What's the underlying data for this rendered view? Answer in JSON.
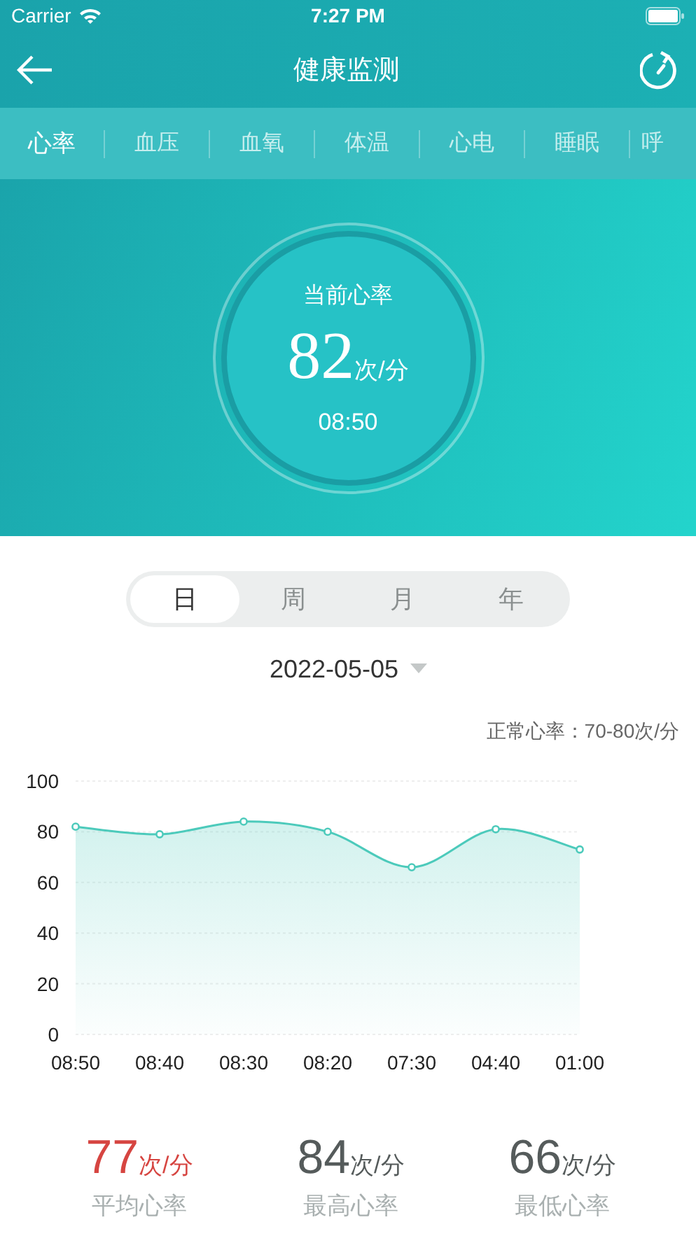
{
  "status_bar": {
    "carrier": "Carrier",
    "time": "7:27 PM"
  },
  "nav": {
    "title": "健康监测"
  },
  "tabs": [
    {
      "label": "心率",
      "selected": true
    },
    {
      "label": "血压",
      "selected": false
    },
    {
      "label": "血氧",
      "selected": false
    },
    {
      "label": "体温",
      "selected": false
    },
    {
      "label": "心电",
      "selected": false
    },
    {
      "label": "睡眠",
      "selected": false
    },
    {
      "label": "呼",
      "selected": false
    }
  ],
  "current": {
    "label": "当前心率",
    "value": "82",
    "unit": "次/分",
    "time": "08:50"
  },
  "periods": [
    {
      "label": "日",
      "selected": true
    },
    {
      "label": "周",
      "selected": false
    },
    {
      "label": "月",
      "selected": false
    },
    {
      "label": "年",
      "selected": false
    }
  ],
  "date": "2022-05-05",
  "normal_range": "正常心率：70-80次/分",
  "chart_data": {
    "type": "area",
    "categories": [
      "08:50",
      "08:40",
      "08:30",
      "08:20",
      "07:30",
      "04:40",
      "01:00"
    ],
    "series": [
      {
        "color": "#4ccabb",
        "values": [
          82,
          79,
          84,
          80,
          66,
          81,
          73
        ]
      }
    ],
    "ylim": [
      0,
      100
    ],
    "grid": true,
    "yticks": [
      0,
      20,
      40,
      60,
      80,
      100
    ]
  },
  "stats": [
    {
      "value": "77",
      "unit": "次/分",
      "label": "平均心率",
      "color": "#d64541"
    },
    {
      "value": "84",
      "unit": "次/分",
      "label": "最高心率",
      "color": "#555b5b"
    },
    {
      "value": "66",
      "unit": "次/分",
      "label": "最低心率",
      "color": "#555b5b"
    }
  ]
}
